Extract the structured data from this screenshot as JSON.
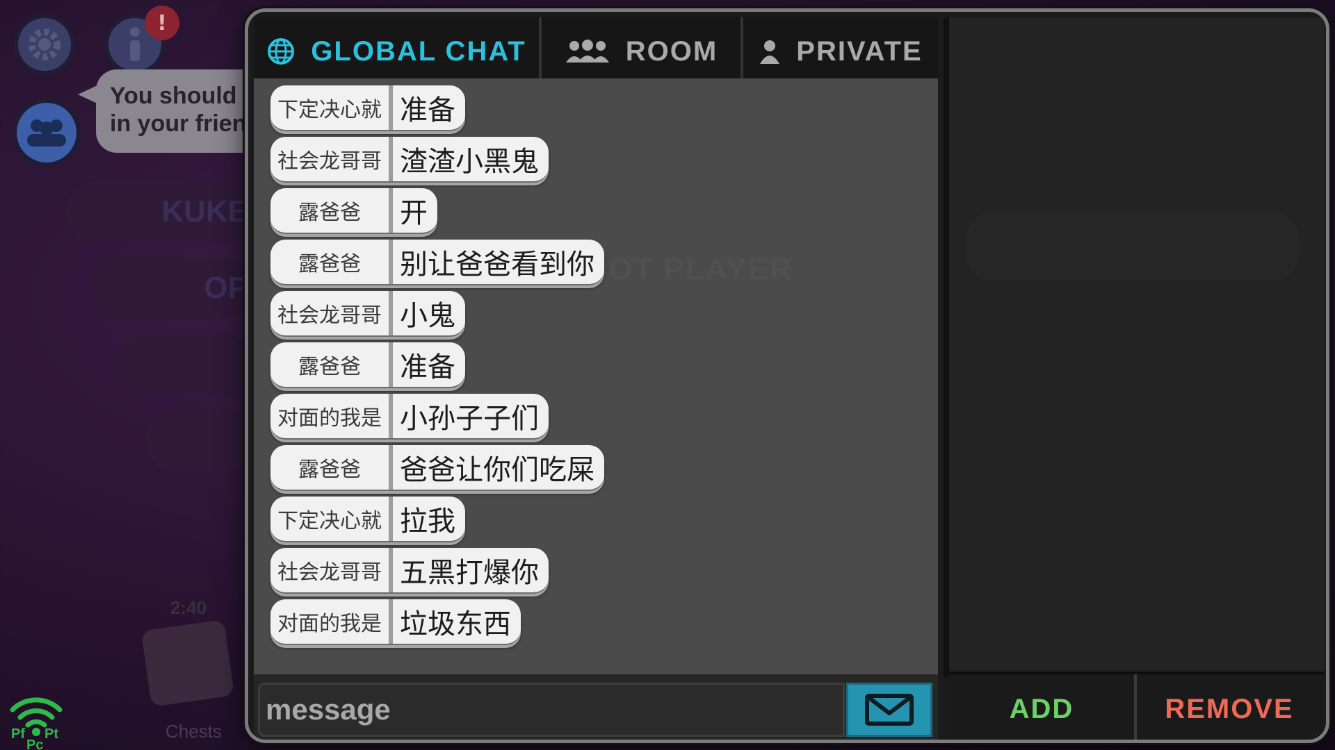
{
  "background": {
    "tooltip_lines": [
      "You should ad",
      "in your friend"
    ],
    "alert_badge": "!",
    "pill_texts": [
      "KUKE",
      "OP"
    ],
    "timer": "2:40",
    "chests_label": "Chests",
    "ghost_text": "OT PLAYER",
    "wifi_labels": {
      "left": "Pf",
      "right": "Pt",
      "bottom": "Pc"
    }
  },
  "tabs": [
    {
      "label": "GLOBAL CHAT",
      "icon": "globe-icon",
      "active": true
    },
    {
      "label": "ROOM",
      "icon": "group-icon",
      "active": false
    },
    {
      "label": "PRIVATE",
      "icon": "person-icon",
      "active": false
    }
  ],
  "messages": [
    {
      "user": "下定决心就",
      "text": "准备"
    },
    {
      "user": "社会龙哥哥",
      "text": "渣渣小黑鬼"
    },
    {
      "user": "露爸爸",
      "text": "开"
    },
    {
      "user": "露爸爸",
      "text": "别让爸爸看到你"
    },
    {
      "user": "社会龙哥哥",
      "text": "小鬼"
    },
    {
      "user": "露爸爸",
      "text": "准备"
    },
    {
      "user": "对面的我是",
      "text": "小孙子子们"
    },
    {
      "user": "露爸爸",
      "text": "爸爸让你们吃屎"
    },
    {
      "user": "下定决心就",
      "text": "拉我"
    },
    {
      "user": "社会龙哥哥",
      "text": "五黑打爆你"
    },
    {
      "user": "对面的我是",
      "text": "垃圾东西"
    }
  ],
  "input": {
    "placeholder": "message",
    "value": ""
  },
  "send_button": {
    "icon": "envelope-icon"
  },
  "actions": {
    "add_label": "ADD",
    "remove_label": "REMOVE"
  },
  "colors": {
    "active_tab": "#2cc0dc",
    "inactive_tab": "#a9a9a9",
    "send_button": "#2494b0",
    "add": "#6bd265",
    "remove": "#ee6a55",
    "chat_bg": "#4b4b4c",
    "bubble": "#f1f1f1"
  }
}
